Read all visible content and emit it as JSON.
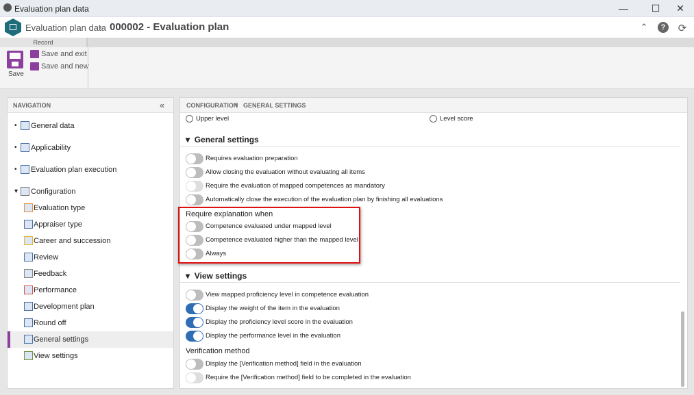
{
  "window": {
    "title": "Evaluation plan data",
    "controls": [
      "minimize",
      "maximize",
      "close"
    ]
  },
  "header": {
    "breadcrumb_root": "Evaluation plan data",
    "title": "000002 - Evaluation plan",
    "icons": [
      "collapse-up-icon",
      "help-icon",
      "refresh-icon"
    ]
  },
  "ribbon": {
    "group": "Record",
    "save": "Save",
    "save_exit": "Save and exit",
    "save_new": "Save and new"
  },
  "nav": {
    "title": "NAVIGATION",
    "items": [
      {
        "label": "General data",
        "level": 0
      },
      {
        "label": "Applicability",
        "level": 0
      },
      {
        "label": "Evaluation plan execution",
        "level": 0
      },
      {
        "label": "Configuration",
        "level": 0,
        "expanded": true
      },
      {
        "label": "Evaluation type",
        "level": 1
      },
      {
        "label": "Appraiser type",
        "level": 1
      },
      {
        "label": "Career and succession",
        "level": 1
      },
      {
        "label": "Review",
        "level": 1
      },
      {
        "label": "Feedback",
        "level": 1
      },
      {
        "label": "Performance",
        "level": 1
      },
      {
        "label": "Development plan",
        "level": 1
      },
      {
        "label": "Round off",
        "level": 1
      },
      {
        "label": "General settings",
        "level": 1,
        "selected": true
      },
      {
        "label": "View settings",
        "level": 1
      }
    ]
  },
  "content": {
    "breadcrumb": [
      "CONFIGURATION",
      "GENERAL SETTINGS"
    ],
    "radios": [
      "Upper level",
      "Level score"
    ],
    "general": {
      "title": "General settings",
      "toggles": [
        {
          "label": "Requires evaluation preparation",
          "state": "off"
        },
        {
          "label": "Allow closing the evaluation without evaluating all items",
          "state": "off"
        },
        {
          "label": "Require the evaluation of mapped competences as mandatory",
          "state": "disabled"
        },
        {
          "label": "Automatically close the execution of the evaluation plan by finishing all evaluations",
          "state": "off"
        }
      ]
    },
    "explain": {
      "title": "Require explanation when",
      "highlight_color": "#e01010",
      "toggles": [
        {
          "label": "Competence evaluated under mapped level",
          "state": "off"
        },
        {
          "label": "Competence evaluated higher than the mapped level",
          "state": "off"
        },
        {
          "label": "Always",
          "state": "off"
        }
      ]
    },
    "view": {
      "title": "View settings",
      "toggles": [
        {
          "label": "View mapped proficiency level in competence evaluation",
          "state": "off"
        },
        {
          "label": "Display the weight of the item in the evaluation",
          "state": "on"
        },
        {
          "label": "Display the proficiency level score in the evaluation",
          "state": "on"
        },
        {
          "label": "Display the performance level in the evaluation",
          "state": "on"
        }
      ]
    },
    "verification": {
      "title": "Verification method",
      "toggles": [
        {
          "label": "Display the [Verification method] field in the evaluation",
          "state": "off"
        },
        {
          "label": "Require the [Verification method] field to be completed in the evaluation",
          "state": "disabled"
        }
      ]
    }
  },
  "colors": {
    "accent": "#8c3f9e",
    "toggle_on": "#2f6db5",
    "brand": "#1d6d7a"
  }
}
